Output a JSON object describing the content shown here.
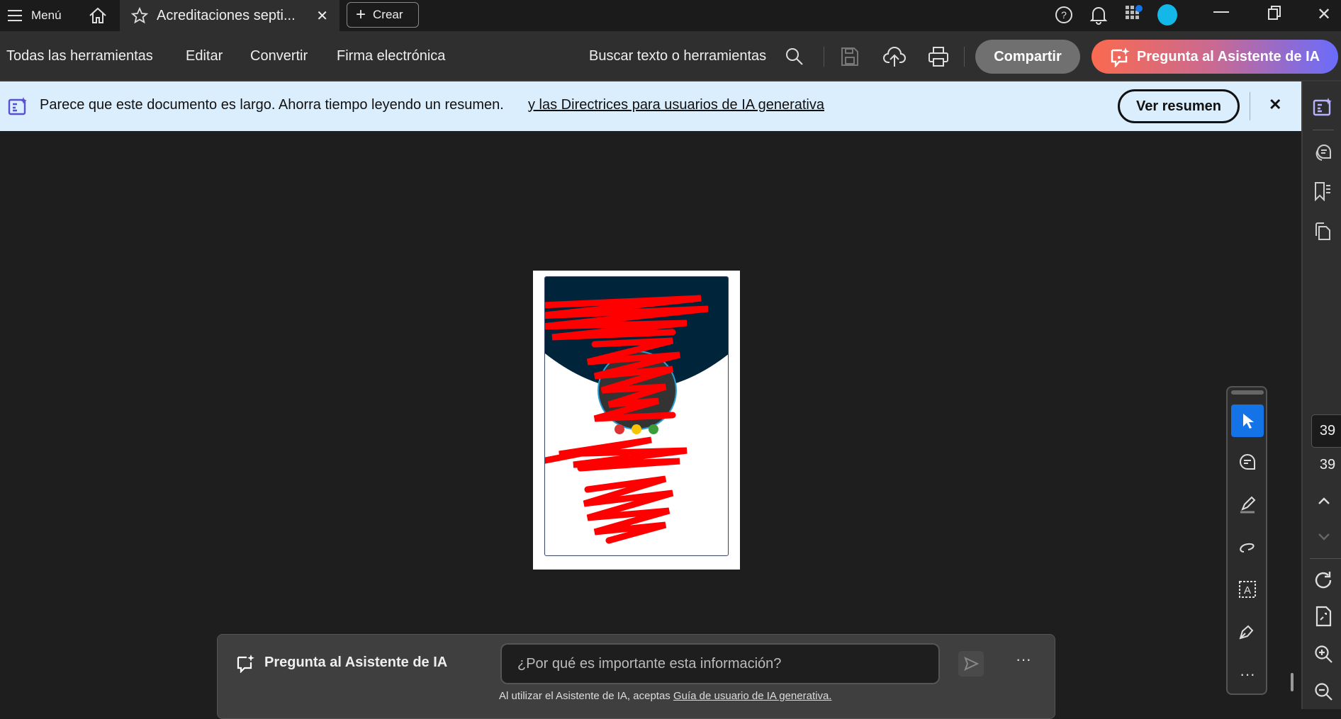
{
  "titlebar": {
    "menu_label": "Menú",
    "tab_title": "Acreditaciones septi...",
    "create_label": "Crear"
  },
  "toolbar": {
    "items": [
      "Todas las herramientas",
      "Editar",
      "Convertir",
      "Firma electrónica"
    ],
    "search_label": "Buscar texto o herramientas",
    "share_label": "Compartir",
    "ai_label": "Pregunta al Asistente de IA"
  },
  "banner": {
    "text": "Parece que este documento es largo. Ahorra tiempo leyendo un resumen.",
    "link": "y las Directrices para usuarios de IA generativa",
    "button": "Ver resumen"
  },
  "pagenav": {
    "current": "39",
    "total": "39"
  },
  "ai_panel": {
    "title": "Pregunta al Asistente de IA",
    "placeholder": "¿Por qué es importante esta información?",
    "disclaimer": "Al utilizar el Asistente de IA, aceptas",
    "disclaimer_link": "Guía de usuario de IA generativa."
  },
  "colors": {
    "accent": "#1473e6",
    "ai_gradient_start": "#fa6a4f",
    "ai_gradient_end": "#6a6cfb",
    "banner_bg": "#dbeefd"
  }
}
